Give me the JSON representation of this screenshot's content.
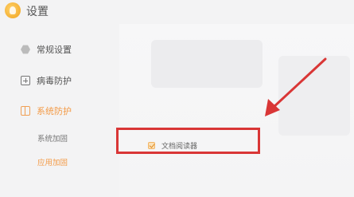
{
  "app": {
    "title": "设置"
  },
  "sidebar": {
    "items": [
      {
        "label": "常规设置",
        "icon": "hexagon-icon",
        "active": false
      },
      {
        "label": "病毒防护",
        "icon": "plus-square-icon",
        "active": false
      },
      {
        "label": "系统防护",
        "icon": "grid-icon",
        "active": true
      }
    ],
    "subitems": [
      {
        "label": "系统加固",
        "active": false
      },
      {
        "label": "应用加固",
        "active": true
      }
    ]
  },
  "content": {
    "option": {
      "label": "文档阅读器",
      "checked": true
    }
  },
  "annotation": {
    "color": "#d93636"
  }
}
